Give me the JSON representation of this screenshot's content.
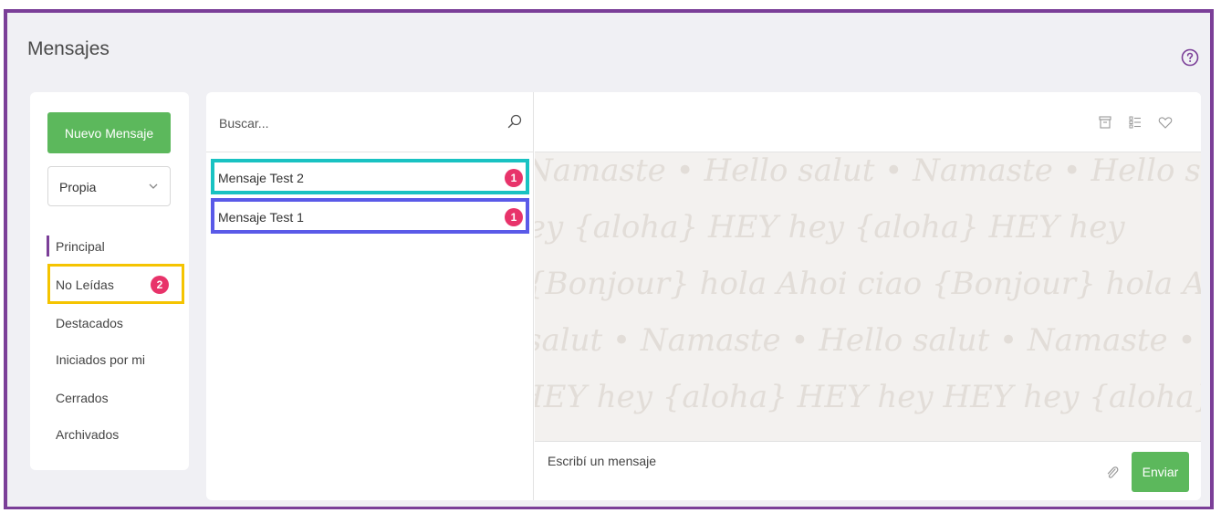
{
  "page": {
    "title": "Mensajes"
  },
  "sidebar": {
    "new_message_label": "Nuevo Mensaje",
    "filter_select": {
      "selected": "Propia"
    },
    "items": [
      {
        "label": "Principal",
        "active": true
      },
      {
        "label": "No Leídas",
        "badge": "2"
      },
      {
        "label": "Destacados"
      },
      {
        "label": "Iniciados por mi"
      },
      {
        "label": "Cerrados"
      },
      {
        "label": "Archivados"
      }
    ]
  },
  "conversations": {
    "search_placeholder": "Buscar...",
    "items": [
      {
        "title": "Mensaje Test 2",
        "unread": "1"
      },
      {
        "title": "Mensaje Test 1",
        "unread": "1"
      }
    ]
  },
  "chat": {
    "header_icons": [
      "archive-icon",
      "list-icon",
      "heart-icon"
    ],
    "pattern_words": [
      "Hello",
      "salut",
      "Namaste",
      "aloha",
      "HEY",
      "hey",
      "Bonjour",
      "hola",
      "Ahoi",
      "ciao"
    ],
    "compose_placeholder": "Escribí un mensaje",
    "send_label": "Enviar"
  },
  "colors": {
    "frame": "#7b3f98",
    "primary_green": "#5cb85c",
    "badge": "#e8336a",
    "highlight_yellow": "#f5c400",
    "highlight_teal": "#19c2c2",
    "highlight_blue": "#5a5ae8"
  }
}
